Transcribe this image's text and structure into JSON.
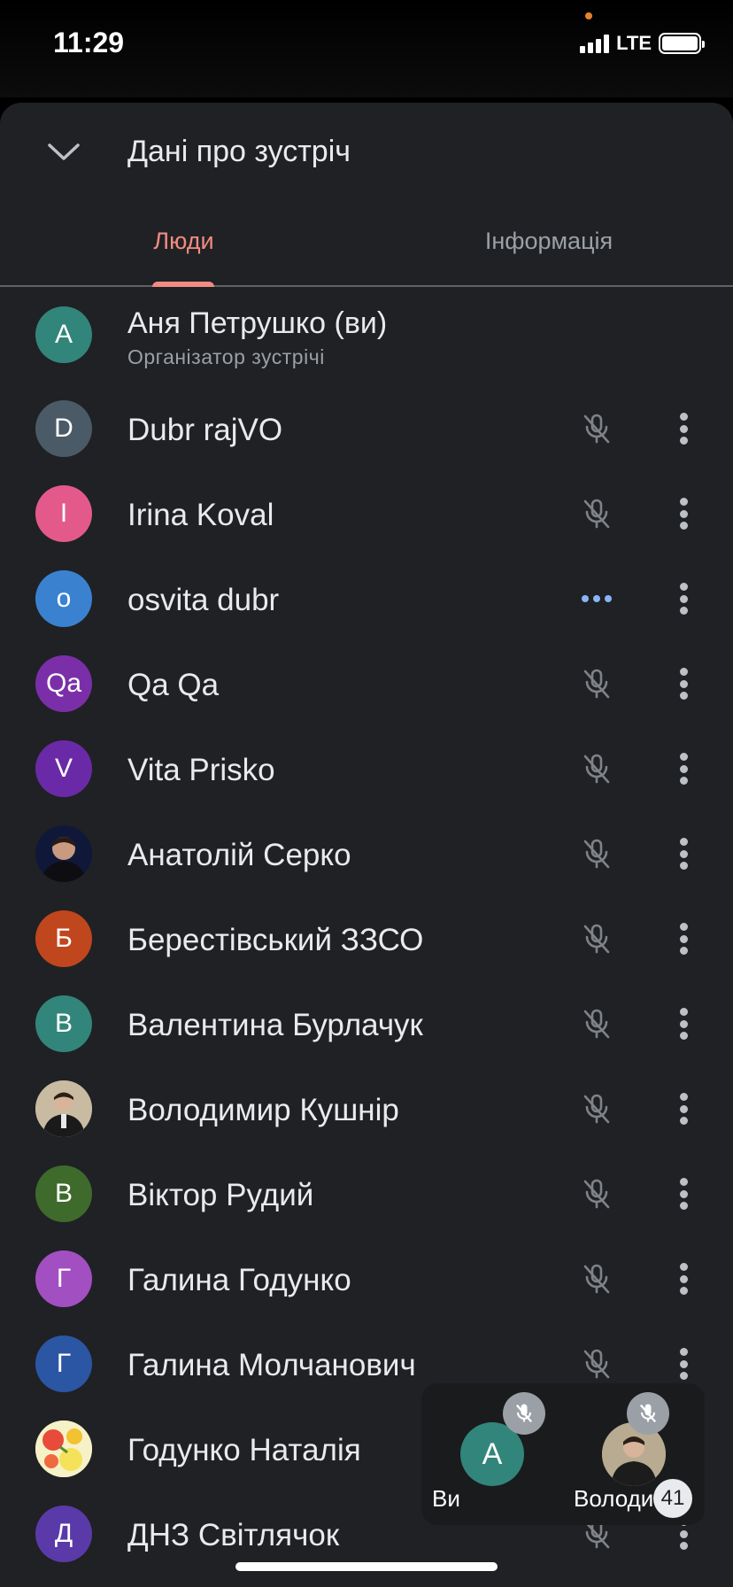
{
  "status_bar": {
    "time": "11:29",
    "network": "LTE"
  },
  "sheet": {
    "title": "Дані про зустріч"
  },
  "tabs": [
    {
      "label": "Люди",
      "active": true
    },
    {
      "label": "Інформація",
      "active": false
    }
  ],
  "organizer": {
    "initial": "А",
    "name": "Аня Петрушко (ви)",
    "role": "Організатор зустрічі",
    "color": "#32857a"
  },
  "participants": [
    {
      "initial": "D",
      "name": "Dubr rajVO",
      "color": "#4a5a66",
      "status": "muted"
    },
    {
      "initial": "I",
      "name": "Irina Koval",
      "color": "#e35a8a",
      "status": "muted"
    },
    {
      "initial": "o",
      "name": "osvita dubr",
      "color": "#3a82d0",
      "status": "connecting"
    },
    {
      "initial": "Qa",
      "name": "Qa Qa",
      "color": "#7a2fa8",
      "status": "muted"
    },
    {
      "initial": "V",
      "name": "Vita Prisko",
      "color": "#6a2aa8",
      "status": "muted"
    },
    {
      "initial": "",
      "name": "Анатолій Серко",
      "color": "#1b2a4a",
      "status": "muted",
      "photo": true
    },
    {
      "initial": "Б",
      "name": "Берестівський ЗЗСО",
      "color": "#c0461e",
      "status": "muted"
    },
    {
      "initial": "В",
      "name": "Валентина Бурлачук",
      "color": "#32857a",
      "status": "muted"
    },
    {
      "initial": "",
      "name": "Володимир Кушнір",
      "color": "#9a8c74",
      "status": "muted",
      "photo": true
    },
    {
      "initial": "В",
      "name": "Віктор Рудий",
      "color": "#3e6a2c",
      "status": "muted"
    },
    {
      "initial": "Г",
      "name": "Галина Годунко",
      "color": "#a24fc2",
      "status": "muted"
    },
    {
      "initial": "Г",
      "name": "Галина Молчанович",
      "color": "#2a56a4",
      "status": "muted"
    },
    {
      "initial": "",
      "name": "Годунко Наталія",
      "color": "#f6e9a8",
      "status": "none",
      "photo": true
    },
    {
      "initial": "Д",
      "name": "ДНЗ Світлячок",
      "color": "#5a3aa8",
      "status": "muted"
    }
  ],
  "pip": {
    "self_initial": "А",
    "self_label": "Ви",
    "other_label": "Володи...",
    "count": "41"
  }
}
